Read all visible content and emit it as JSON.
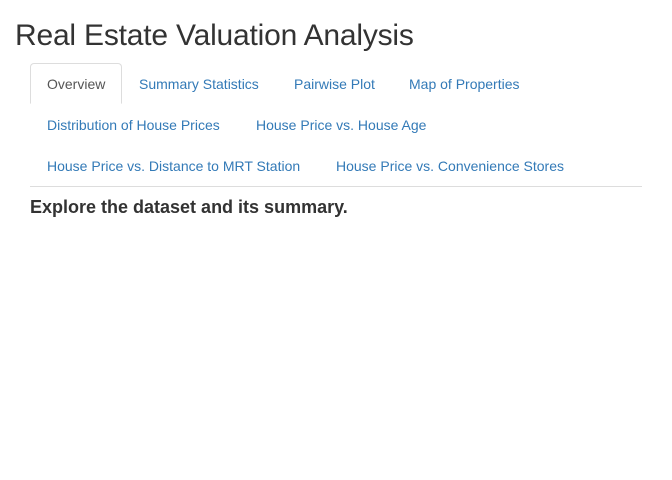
{
  "app": {
    "title": "Real Estate Valuation Analysis"
  },
  "tabs": [
    {
      "label": "Overview",
      "active": true
    },
    {
      "label": "Summary Statistics",
      "active": false
    },
    {
      "label": "Pairwise Plot",
      "active": false
    },
    {
      "label": "Map of Properties",
      "active": false
    },
    {
      "label": "Distribution of House Prices",
      "active": false
    },
    {
      "label": "House Price vs. House Age",
      "active": false
    },
    {
      "label": "House Price vs. Distance to MRT Station",
      "active": false
    },
    {
      "label": "House Price vs. Convenience Stores",
      "active": false
    }
  ],
  "overview": {
    "heading": "Explore the dataset and its summary."
  },
  "colors": {
    "link": "#337ab7",
    "active_tab_text": "#555555",
    "text": "#333333",
    "border": "#dddddd"
  }
}
